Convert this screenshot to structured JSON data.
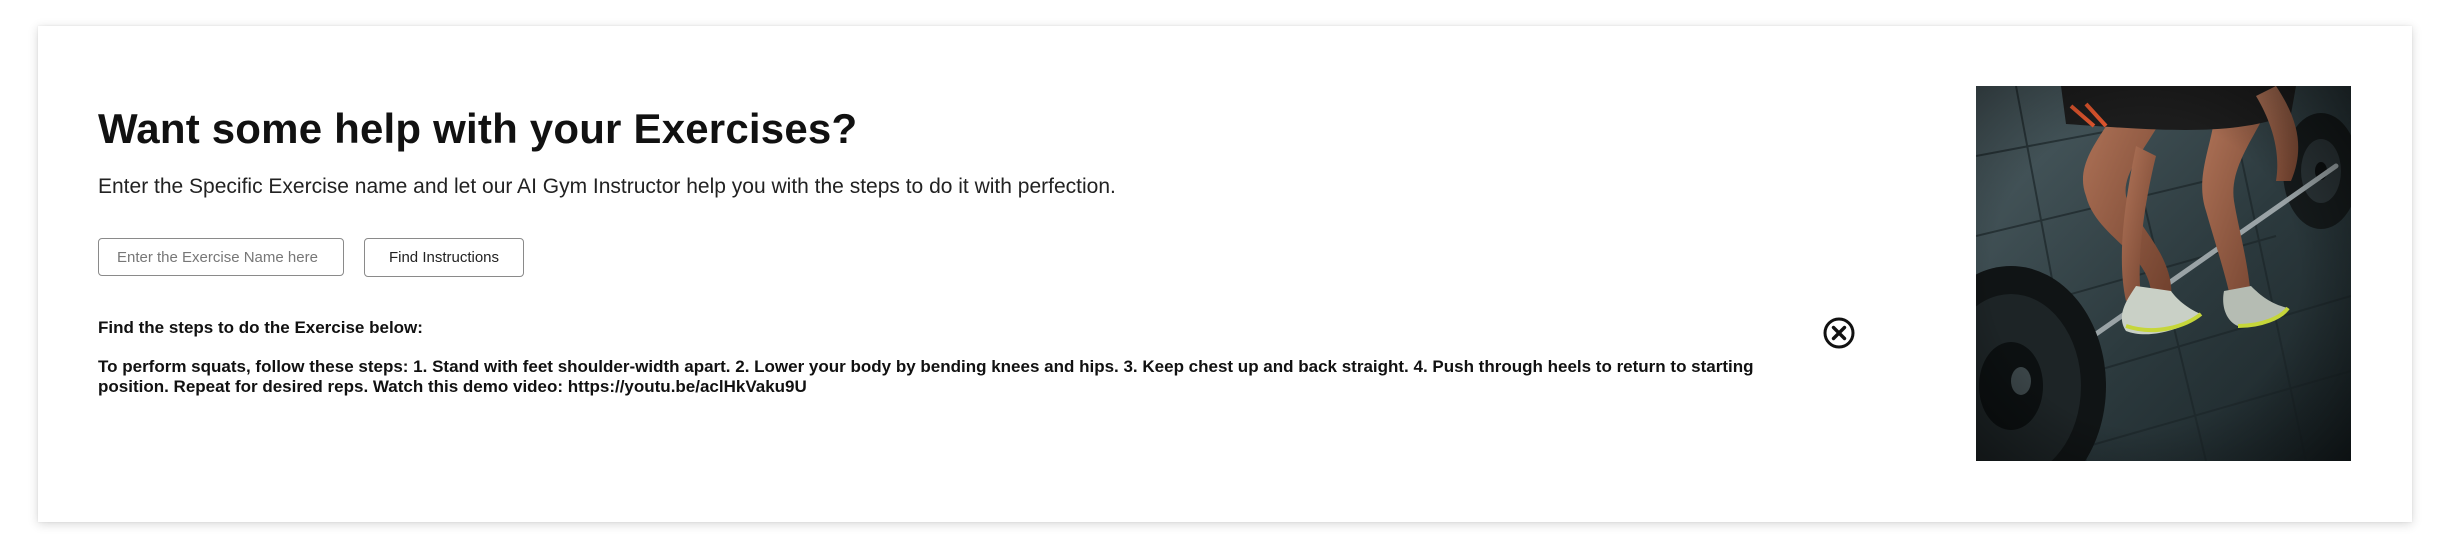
{
  "header": {
    "title": "Want some help with your Exercises?",
    "subtitle": "Enter the Specific Exercise name and let our AI Gym Instructor help you with the steps to do it with perfection."
  },
  "search": {
    "value": "",
    "placeholder": "Enter the Exercise Name here",
    "button_label": "Find Instructions"
  },
  "result": {
    "heading": "Find the steps to do the Exercise below:",
    "text": "To perform squats, follow these steps: 1. Stand with feet shoulder-width apart. 2. Lower your body by bending knees and hips. 3. Keep chest up and back straight. 4. Push through heels to return to starting position. Repeat for desired reps. Watch this demo video: https://youtu.be/aclHkVaku9U"
  },
  "icons": {
    "close": "close-circle-icon"
  },
  "image": {
    "subject": "person lifting a barbell on gym floor"
  },
  "colors": {
    "text": "#111111",
    "border": "#8a8a8a",
    "background": "#ffffff"
  }
}
